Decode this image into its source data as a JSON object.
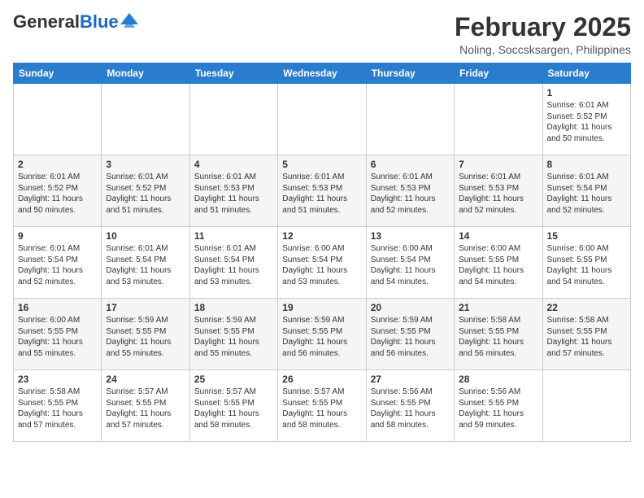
{
  "header": {
    "logo_general": "General",
    "logo_blue": "Blue",
    "month_year": "February 2025",
    "location": "Noling, Soccsksargen, Philippines"
  },
  "weekdays": [
    "Sunday",
    "Monday",
    "Tuesday",
    "Wednesday",
    "Thursday",
    "Friday",
    "Saturday"
  ],
  "weeks": [
    {
      "row_class": "row-week1",
      "days": [
        {
          "num": "",
          "info": ""
        },
        {
          "num": "",
          "info": ""
        },
        {
          "num": "",
          "info": ""
        },
        {
          "num": "",
          "info": ""
        },
        {
          "num": "",
          "info": ""
        },
        {
          "num": "",
          "info": ""
        },
        {
          "num": "1",
          "info": "Sunrise: 6:01 AM\nSunset: 5:52 PM\nDaylight: 11 hours\nand 50 minutes."
        }
      ]
    },
    {
      "row_class": "row-week2",
      "days": [
        {
          "num": "2",
          "info": "Sunrise: 6:01 AM\nSunset: 5:52 PM\nDaylight: 11 hours\nand 50 minutes."
        },
        {
          "num": "3",
          "info": "Sunrise: 6:01 AM\nSunset: 5:52 PM\nDaylight: 11 hours\nand 51 minutes."
        },
        {
          "num": "4",
          "info": "Sunrise: 6:01 AM\nSunset: 5:53 PM\nDaylight: 11 hours\nand 51 minutes."
        },
        {
          "num": "5",
          "info": "Sunrise: 6:01 AM\nSunset: 5:53 PM\nDaylight: 11 hours\nand 51 minutes."
        },
        {
          "num": "6",
          "info": "Sunrise: 6:01 AM\nSunset: 5:53 PM\nDaylight: 11 hours\nand 52 minutes."
        },
        {
          "num": "7",
          "info": "Sunrise: 6:01 AM\nSunset: 5:53 PM\nDaylight: 11 hours\nand 52 minutes."
        },
        {
          "num": "8",
          "info": "Sunrise: 6:01 AM\nSunset: 5:54 PM\nDaylight: 11 hours\nand 52 minutes."
        }
      ]
    },
    {
      "row_class": "row-week3",
      "days": [
        {
          "num": "9",
          "info": "Sunrise: 6:01 AM\nSunset: 5:54 PM\nDaylight: 11 hours\nand 52 minutes."
        },
        {
          "num": "10",
          "info": "Sunrise: 6:01 AM\nSunset: 5:54 PM\nDaylight: 11 hours\nand 53 minutes."
        },
        {
          "num": "11",
          "info": "Sunrise: 6:01 AM\nSunset: 5:54 PM\nDaylight: 11 hours\nand 53 minutes."
        },
        {
          "num": "12",
          "info": "Sunrise: 6:00 AM\nSunset: 5:54 PM\nDaylight: 11 hours\nand 53 minutes."
        },
        {
          "num": "13",
          "info": "Sunrise: 6:00 AM\nSunset: 5:54 PM\nDaylight: 11 hours\nand 54 minutes."
        },
        {
          "num": "14",
          "info": "Sunrise: 6:00 AM\nSunset: 5:55 PM\nDaylight: 11 hours\nand 54 minutes."
        },
        {
          "num": "15",
          "info": "Sunrise: 6:00 AM\nSunset: 5:55 PM\nDaylight: 11 hours\nand 54 minutes."
        }
      ]
    },
    {
      "row_class": "row-week4",
      "days": [
        {
          "num": "16",
          "info": "Sunrise: 6:00 AM\nSunset: 5:55 PM\nDaylight: 11 hours\nand 55 minutes."
        },
        {
          "num": "17",
          "info": "Sunrise: 5:59 AM\nSunset: 5:55 PM\nDaylight: 11 hours\nand 55 minutes."
        },
        {
          "num": "18",
          "info": "Sunrise: 5:59 AM\nSunset: 5:55 PM\nDaylight: 11 hours\nand 55 minutes."
        },
        {
          "num": "19",
          "info": "Sunrise: 5:59 AM\nSunset: 5:55 PM\nDaylight: 11 hours\nand 56 minutes."
        },
        {
          "num": "20",
          "info": "Sunrise: 5:59 AM\nSunset: 5:55 PM\nDaylight: 11 hours\nand 56 minutes."
        },
        {
          "num": "21",
          "info": "Sunrise: 5:58 AM\nSunset: 5:55 PM\nDaylight: 11 hours\nand 56 minutes."
        },
        {
          "num": "22",
          "info": "Sunrise: 5:58 AM\nSunset: 5:55 PM\nDaylight: 11 hours\nand 57 minutes."
        }
      ]
    },
    {
      "row_class": "row-week5",
      "days": [
        {
          "num": "23",
          "info": "Sunrise: 5:58 AM\nSunset: 5:55 PM\nDaylight: 11 hours\nand 57 minutes."
        },
        {
          "num": "24",
          "info": "Sunrise: 5:57 AM\nSunset: 5:55 PM\nDaylight: 11 hours\nand 57 minutes."
        },
        {
          "num": "25",
          "info": "Sunrise: 5:57 AM\nSunset: 5:55 PM\nDaylight: 11 hours\nand 58 minutes."
        },
        {
          "num": "26",
          "info": "Sunrise: 5:57 AM\nSunset: 5:55 PM\nDaylight: 11 hours\nand 58 minutes."
        },
        {
          "num": "27",
          "info": "Sunrise: 5:56 AM\nSunset: 5:55 PM\nDaylight: 11 hours\nand 58 minutes."
        },
        {
          "num": "28",
          "info": "Sunrise: 5:56 AM\nSunset: 5:55 PM\nDaylight: 11 hours\nand 59 minutes."
        },
        {
          "num": "",
          "info": ""
        }
      ]
    }
  ]
}
